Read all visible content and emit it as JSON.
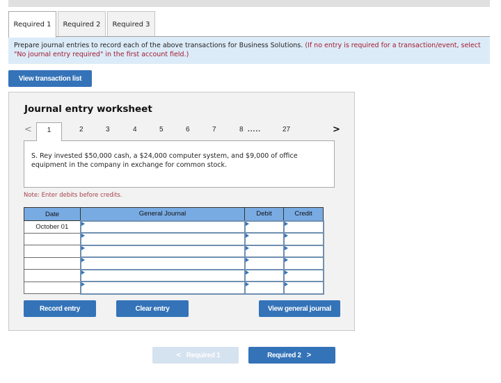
{
  "tabs": [
    {
      "label": "Required 1",
      "active": true
    },
    {
      "label": "Required 2",
      "active": false
    },
    {
      "label": "Required 3",
      "active": false
    }
  ],
  "instructions": {
    "main": "Prepare journal entries to record each of the above transactions for Business Solutions.",
    "note": "(If no entry is required for a transaction/event, select \"No journal entry required\" in the first account field.)"
  },
  "buttons": {
    "view_transaction_list": "View transaction list",
    "record_entry": "Record entry",
    "clear_entry": "Clear entry",
    "view_general_journal": "View general journal",
    "prev": "Required 1",
    "next": "Required 2"
  },
  "worksheet": {
    "title": "Journal entry worksheet",
    "pages": [
      "1",
      "2",
      "3",
      "4",
      "5",
      "6",
      "7",
      "8"
    ],
    "ellipsis": ".....",
    "last_page": "27",
    "active_page": "1",
    "description": "S. Rey invested $50,000 cash, a $24,000 computer system, and $9,000 of office equipment in the company in exchange for common stock.",
    "note": "Note: Enter debits before credits."
  },
  "table": {
    "headers": {
      "date": "Date",
      "journal": "General Journal",
      "debit": "Debit",
      "credit": "Credit"
    },
    "rows": [
      {
        "date": "October 01",
        "account": "",
        "debit": "",
        "credit": ""
      },
      {
        "date": "",
        "account": "",
        "debit": "",
        "credit": ""
      },
      {
        "date": "",
        "account": "",
        "debit": "",
        "credit": ""
      },
      {
        "date": "",
        "account": "",
        "debit": "",
        "credit": ""
      },
      {
        "date": "",
        "account": "",
        "debit": "",
        "credit": ""
      },
      {
        "date": "",
        "account": "",
        "debit": "",
        "credit": ""
      }
    ]
  },
  "icons": {
    "left_arrow": "‹",
    "right_arrow": "›",
    "chevron_left": "<",
    "chevron_right": ">"
  }
}
